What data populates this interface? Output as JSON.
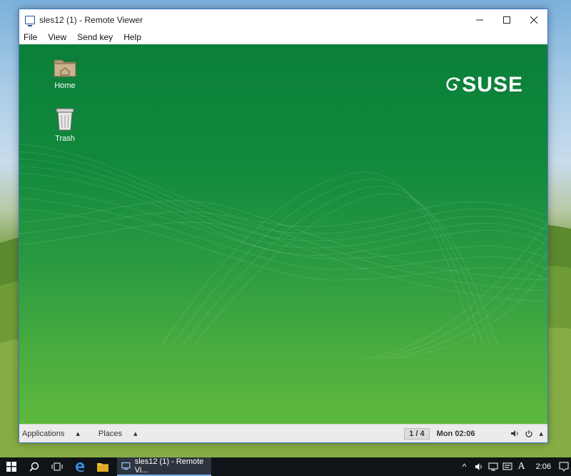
{
  "window": {
    "title": "sles12 (1) - Remote Viewer",
    "menu": [
      "File",
      "View",
      "Send key",
      "Help"
    ]
  },
  "desktop": {
    "icons": [
      {
        "label": "Home",
        "icon": "folder-home-icon"
      },
      {
        "label": "Trash",
        "icon": "trash-icon"
      }
    ],
    "logo_text": "SUSE"
  },
  "gnome_panel": {
    "applications": "Applications",
    "places": "Places",
    "workspace": "1 / 4",
    "clock": "Mon 02:06"
  },
  "taskbar": {
    "app_label": "sles12 (1) - Remote Vi...",
    "ime": "A",
    "clock": "2:06"
  },
  "colors": {
    "suse_green": "#0b7f3a",
    "suse_light_green": "#63bb3c",
    "taskbar": "#101418"
  }
}
